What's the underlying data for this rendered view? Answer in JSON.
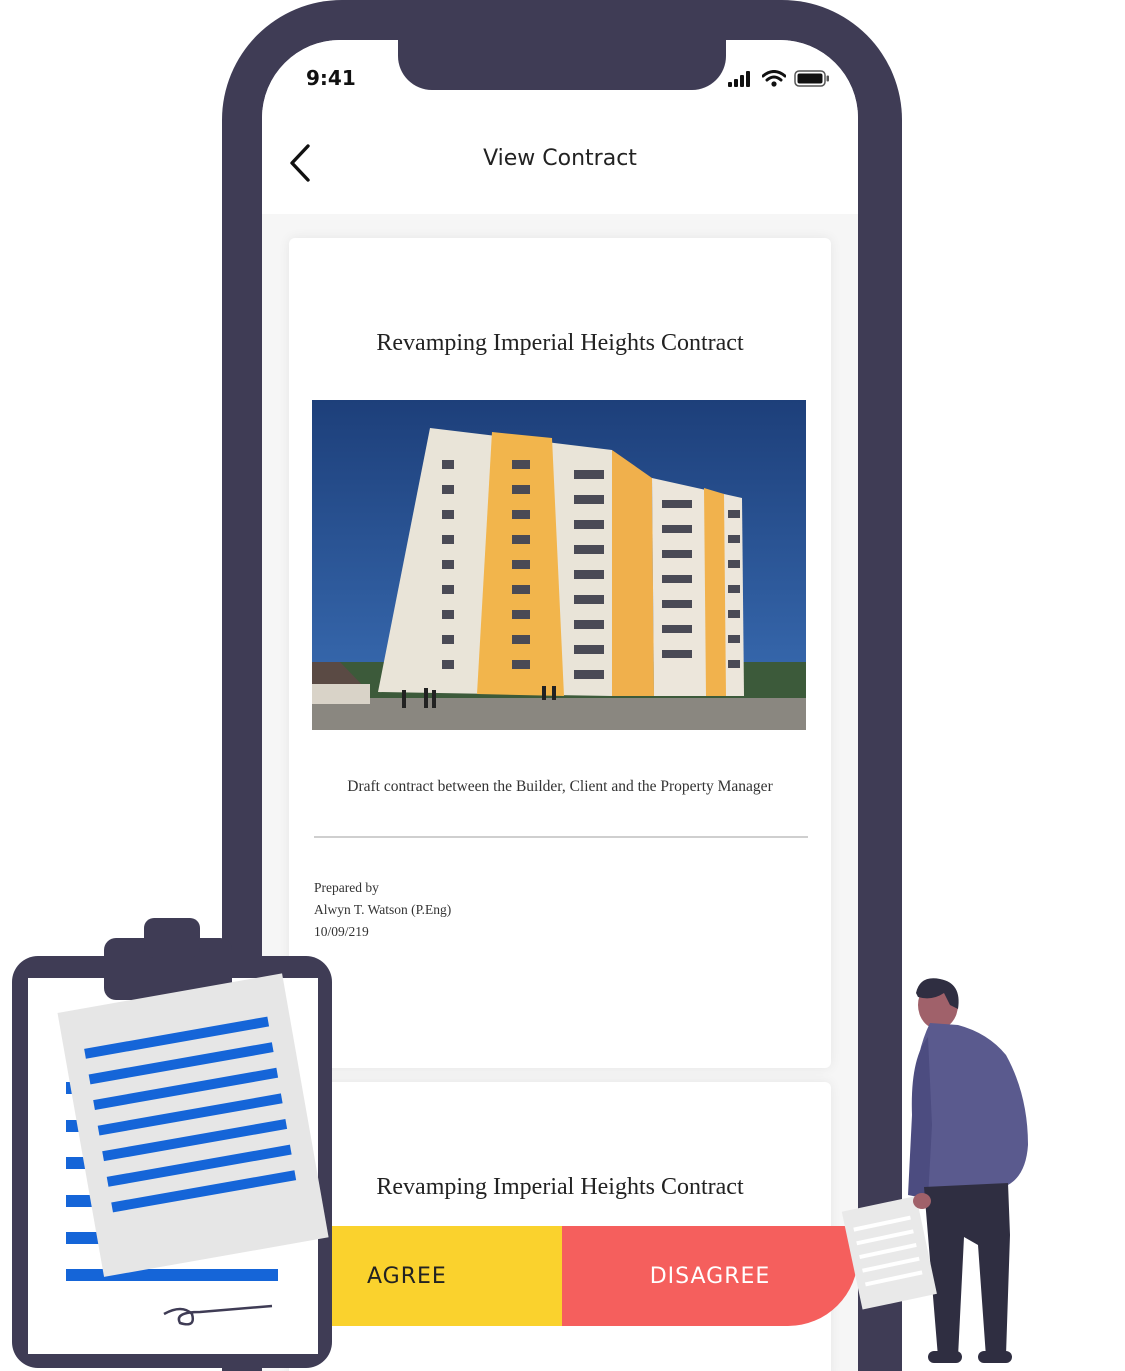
{
  "status_bar": {
    "time": "9:41"
  },
  "navbar": {
    "title": "View Contract"
  },
  "contract_card": {
    "title": "Revamping Imperial Heights Contract",
    "caption": "Draft contract between the Builder, Client and the Property Manager",
    "prepared_label": "Prepared by",
    "author": "Alwyn T. Watson (P.Eng)",
    "date": "10/09/219"
  },
  "second_card": {
    "title": "Revamping Imperial Heights Contract"
  },
  "actions": {
    "agree_label": "AGREE",
    "disagree_label": "DISAGREE"
  },
  "colors": {
    "phone_frame": "#3f3c55",
    "agree": "#fad22d",
    "disagree": "#f55f5d",
    "clipboard_lines": "#1565d8",
    "person_shirt": "#5a5a8e"
  },
  "icons": [
    "back-chevron-icon",
    "signal-icon",
    "wifi-icon",
    "battery-icon",
    "clipboard-illustration",
    "person-illustration"
  ]
}
